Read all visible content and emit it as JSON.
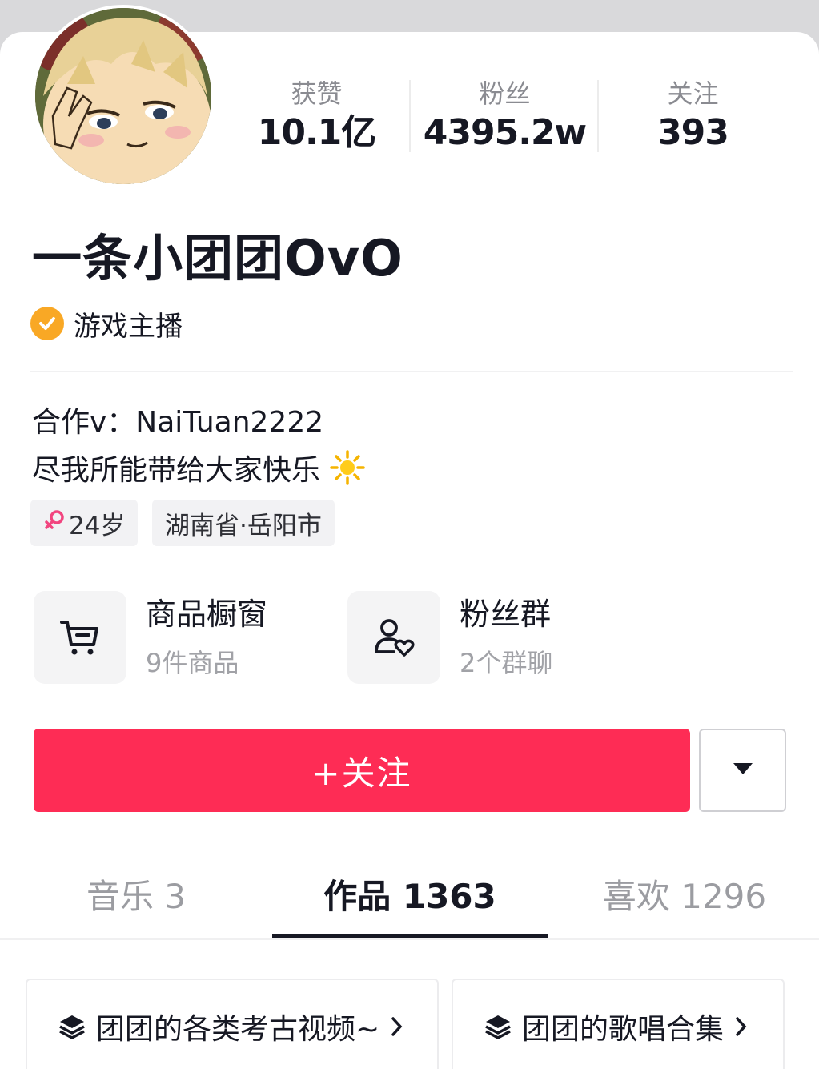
{
  "profile": {
    "nickname": "一条小团团OvO",
    "verification": "游戏主播",
    "avatar_alt": "avatar"
  },
  "stats": [
    {
      "label": "获赞",
      "value": "10.1亿"
    },
    {
      "label": "粉丝",
      "value": "4395.2w"
    },
    {
      "label": "关注",
      "value": "393"
    }
  ],
  "bio": {
    "line1": "合作v：NaiTuan2222",
    "line2": "尽我所能带给大家快乐",
    "line2_emoji": "☀️"
  },
  "tags": {
    "gender_icon": "female-icon",
    "age": "24岁",
    "location": "湖南省·岳阳市"
  },
  "features": {
    "shop_title": "商品橱窗",
    "shop_sub": "9件商品",
    "fans_title": "粉丝群",
    "fans_sub": "2个群聊"
  },
  "actions": {
    "follow_label": "+关注",
    "more_icon": "caret-down-icon"
  },
  "tabs": [
    {
      "label": "音乐 3",
      "active": false
    },
    {
      "label": "作品 1363",
      "active": true
    },
    {
      "label": "喜欢 1296",
      "active": false
    }
  ],
  "collections": [
    {
      "label": "团团的各类考古视频~"
    },
    {
      "label": "团团的歌唱合集"
    }
  ],
  "colors": {
    "accent": "#fe2c55",
    "verify_badge": "#f9a825",
    "female": "#f2457f"
  }
}
